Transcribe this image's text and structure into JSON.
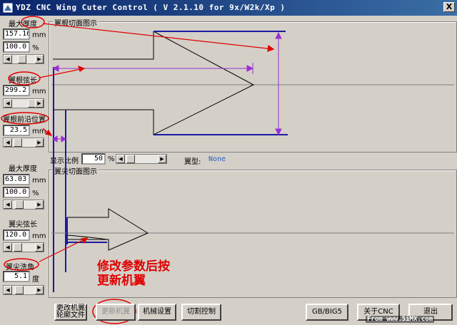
{
  "window": {
    "title": "YDZ CNC Wing Cuter Control ( V 2.1.10 for 9x/W2k/Xp )",
    "close_glyph": "X"
  },
  "left_panel": {
    "root": {
      "max_thickness_label": "最大厚度",
      "max_thickness_value": "157.16",
      "max_thickness_unit": "mm",
      "percent_value": "100.0",
      "percent_unit": "%",
      "chord_label": "翼根弦长",
      "chord_value": "299.2",
      "chord_unit": "mm",
      "leading_edge_label": "翼根前沿位置",
      "leading_edge_value": "23.5",
      "leading_edge_unit": "mm"
    },
    "tip": {
      "max_thickness_label": "最大厚度",
      "max_thickness_value": "63.03",
      "max_thickness_unit": "mm",
      "percent_value": "100.0",
      "percent_unit": "%",
      "chord_label": "翼尖弦长",
      "chord_value": "120.0",
      "chord_unit": "mm",
      "sweep_label": "翼尖洗角",
      "sweep_value": "5.1",
      "sweep_unit": "度"
    }
  },
  "root_view": {
    "title": "翼根切面图示"
  },
  "tip_view": {
    "title": "翼尖切面图示"
  },
  "display_bar": {
    "scale_label": "显示比例",
    "scale_value": "50",
    "scale_unit": "%",
    "airfoil_label": "翼型:",
    "airfoil_value": "None"
  },
  "buttons": {
    "change_airfoil_line1": "更改机翼",
    "change_airfoil_line2": "轮廓文件",
    "update_wing": "更新机翼",
    "machine_settings": "机械设置",
    "cut_control": "切割控制",
    "gb_big5": "GB/BIG5",
    "about": "关于CNC",
    "exit": "退出"
  },
  "annotation": {
    "line1": "修改参数后按",
    "line2": "更新机翼"
  },
  "watermark": "From www.5iMX.com",
  "colors": {
    "annotation_red": "#e00000",
    "drawing_blue": "#1a1aa0",
    "dimension_purple": "#9b30d0",
    "title_blue": "#0a246a"
  }
}
